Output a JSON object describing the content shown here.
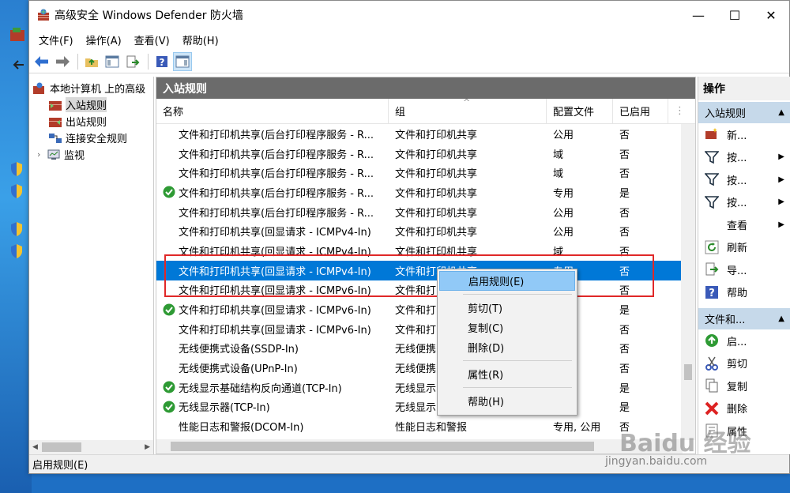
{
  "window": {
    "title": "高级安全 Windows Defender 防火墙",
    "controls": {
      "minimize": "—",
      "maximize": "☐",
      "close": "✕"
    }
  },
  "menu": [
    "文件(F)",
    "操作(A)",
    "查看(V)",
    "帮助(H)"
  ],
  "tree": {
    "root": "本地计算机 上的高级",
    "items": [
      "入站规则",
      "出站规则",
      "连接安全规则",
      "监视"
    ]
  },
  "center": {
    "header": "入站规则",
    "columns": [
      "名称",
      "组",
      "配置文件",
      "已启用"
    ],
    "sort_indicator": "^",
    "rows": [
      {
        "name": "文件和打印机共享(后台打印程序服务 - R...",
        "group": "文件和打印机共享",
        "profile": "公用",
        "enabled": "否",
        "check": false
      },
      {
        "name": "文件和打印机共享(后台打印程序服务 - R...",
        "group": "文件和打印机共享",
        "profile": "域",
        "enabled": "否",
        "check": false
      },
      {
        "name": "文件和打印机共享(后台打印程序服务 - R...",
        "group": "文件和打印机共享",
        "profile": "域",
        "enabled": "否",
        "check": false
      },
      {
        "name": "文件和打印机共享(后台打印程序服务 - R...",
        "group": "文件和打印机共享",
        "profile": "专用",
        "enabled": "是",
        "check": true
      },
      {
        "name": "文件和打印机共享(后台打印程序服务 - R...",
        "group": "文件和打印机共享",
        "profile": "公用",
        "enabled": "否",
        "check": false
      },
      {
        "name": "文件和打印机共享(回显请求 - ICMPv4-In)",
        "group": "文件和打印机共享",
        "profile": "公用",
        "enabled": "否",
        "check": false
      },
      {
        "name": "文件和打印机共享(回显请求 - ICMPv4-In)",
        "group": "文件和打印机共享",
        "profile": "域",
        "enabled": "否",
        "check": false
      },
      {
        "name": "文件和打印机共享(回显请求 - ICMPv4-In)",
        "group": "文件和打印机共享",
        "profile": "专用",
        "enabled": "否",
        "check": false,
        "selected": true
      },
      {
        "name": "文件和打印机共享(回显请求 - ICMPv6-In)",
        "group": "文件和打",
        "profile": "",
        "enabled": "否",
        "check": false
      },
      {
        "name": "文件和打印机共享(回显请求 - ICMPv6-In)",
        "group": "文件和打",
        "profile": "",
        "enabled": "是",
        "check": true
      },
      {
        "name": "文件和打印机共享(回显请求 - ICMPv6-In)",
        "group": "文件和打",
        "profile": "",
        "enabled": "否",
        "check": false
      },
      {
        "name": "无线便携式设备(SSDP-In)",
        "group": "无线便携",
        "profile": "",
        "enabled": "否",
        "check": false
      },
      {
        "name": "无线便携式设备(UPnP-In)",
        "group": "无线便携",
        "profile": "",
        "enabled": "否",
        "check": false
      },
      {
        "name": "无线显示基础结构反向通道(TCP-In)",
        "group": "无线显示",
        "profile": "",
        "enabled": "是",
        "check": true
      },
      {
        "name": "无线显示器(TCP-In)",
        "group": "无线显示",
        "profile": "",
        "enabled": "是",
        "check": true
      },
      {
        "name": "性能日志和警报(DCOM-In)",
        "group": "性能日志和警报",
        "profile": "专用, 公用",
        "enabled": "否",
        "check": false
      }
    ]
  },
  "actions": {
    "header": "操作",
    "section1": "入站规则",
    "items1": [
      {
        "label": "新...",
        "icon": "new-rule-icon",
        "sub": false
      },
      {
        "label": "按...",
        "icon": "filter-icon",
        "sub": true
      },
      {
        "label": "按...",
        "icon": "filter-icon",
        "sub": true
      },
      {
        "label": "按...",
        "icon": "filter-icon",
        "sub": true
      },
      {
        "label": "查看",
        "icon": "",
        "sub": true
      },
      {
        "label": "刷新",
        "icon": "refresh-icon",
        "sub": false
      },
      {
        "label": "导...",
        "icon": "export-icon",
        "sub": false
      },
      {
        "label": "帮助",
        "icon": "help-icon",
        "sub": false
      }
    ],
    "section2": "文件和...",
    "items2": [
      {
        "label": "启...",
        "icon": "enable-icon"
      },
      {
        "label": "剪切",
        "icon": "cut-icon"
      },
      {
        "label": "复制",
        "icon": "copy-icon"
      },
      {
        "label": "删除",
        "icon": "delete-icon"
      },
      {
        "label": "属性",
        "icon": "properties-icon"
      }
    ]
  },
  "context_menu": {
    "items": [
      "启用规则(E)",
      "剪切(T)",
      "复制(C)",
      "删除(D)",
      "属性(R)",
      "帮助(H)"
    ]
  },
  "status": "启用规则(E)",
  "watermark": {
    "main": "Baidu 经验",
    "sub": "jingyan.baidu.com"
  },
  "colors": {
    "selection": "#0078d7",
    "highlight_box": "#e02828",
    "menu_hot": "#91c9f7",
    "section_bg": "#c6d9ea"
  }
}
